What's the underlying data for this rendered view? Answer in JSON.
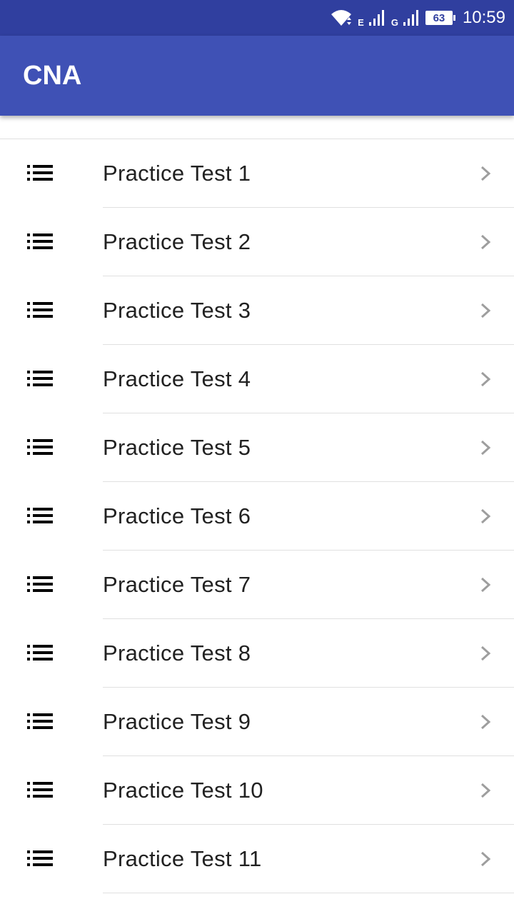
{
  "status_bar": {
    "network_a": "E",
    "network_b": "G",
    "battery": "63",
    "time": "10:59",
    "icons": [
      "wifi-icon",
      "signal-icon",
      "signal-icon",
      "battery-icon"
    ]
  },
  "app_bar": {
    "title": "CNA"
  },
  "list": {
    "item_icon": "list-icon",
    "trailing_icon": "chevron-right-icon",
    "items": [
      {
        "label": "Practice Test 1"
      },
      {
        "label": "Practice Test 2"
      },
      {
        "label": "Practice Test 3"
      },
      {
        "label": "Practice Test 4"
      },
      {
        "label": "Practice Test 5"
      },
      {
        "label": "Practice Test 6"
      },
      {
        "label": "Practice Test 7"
      },
      {
        "label": "Practice Test 8"
      },
      {
        "label": "Practice Test 9"
      },
      {
        "label": "Practice Test 10"
      },
      {
        "label": "Practice Test 11"
      }
    ]
  },
  "colors": {
    "status_bar": "#303f9f",
    "app_bar": "#3f51b5",
    "text": "#212121",
    "divider": "#e0e0e0",
    "chevron": "#9e9e9e"
  }
}
